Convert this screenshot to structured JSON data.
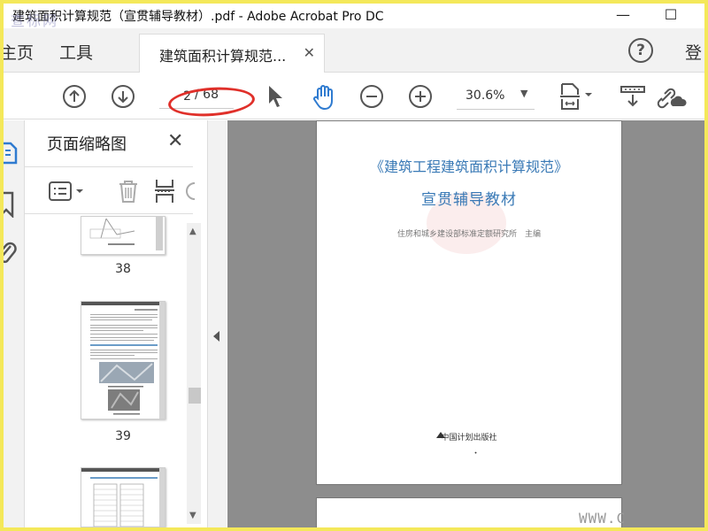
{
  "window": {
    "title": "建筑面积计算规范（宣贯辅导教材）.pdf - Adobe Acrobat Pro DC",
    "watermark": "查标网"
  },
  "tabs": {
    "home": "主页",
    "tools": "工具",
    "document": "建筑面积计算规范...",
    "help": "?",
    "login": "登"
  },
  "toolbar": {
    "current_page": "2",
    "total_pages": "/ 68",
    "zoom": "30.6%"
  },
  "thumbnails": {
    "title": "页面缩略图",
    "pages": [
      {
        "number": "38"
      },
      {
        "number": "39"
      }
    ]
  },
  "document": {
    "book_title": "《建筑工程建筑面积计算规范》",
    "subtitle": "宣贯辅导教材",
    "editor": "住房和城乡建设部标准定额研究所　主编",
    "publisher": "中国计划出版社",
    "url_watermark": "WWW.C"
  },
  "colors": {
    "frame": "#f4e85a",
    "title_blue": "#3a7ab6",
    "highlight_red": "#e0302a",
    "hand_tool_blue": "#2f7bd0"
  }
}
